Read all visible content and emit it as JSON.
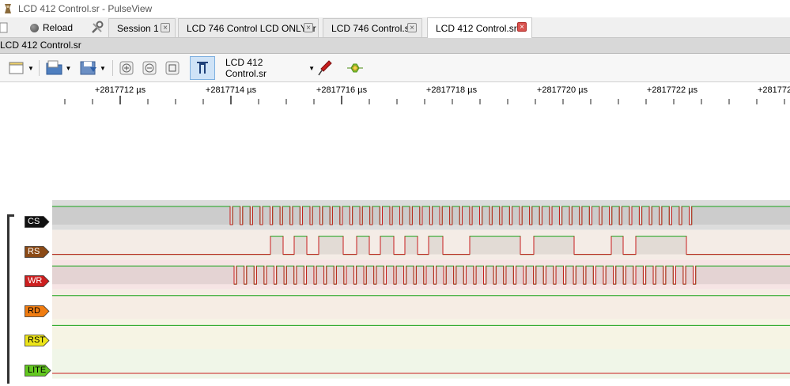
{
  "window": {
    "title": "LCD 412 Control.sr - PulseView"
  },
  "toolbar_top": {
    "reload_label": "Reload"
  },
  "tabs": [
    {
      "label": "Session 1",
      "active": false
    },
    {
      "label": "LCD 746 Control LCD ONLY.sr",
      "active": false
    },
    {
      "label": "LCD 746 Control.sr",
      "active": false
    },
    {
      "label": "LCD 412 Control.sr",
      "active": true
    }
  ],
  "session": {
    "name": "LCD 412 Control.sr",
    "device_label": "LCD 412 Control.sr"
  },
  "ruler": {
    "tick_labels": [
      "+2817712 µs",
      "+2817714 µs",
      "+2817716 µs",
      "+2817718 µs",
      "+2817720 µs",
      "+2817722 µs",
      "+281772"
    ]
  },
  "channels": [
    {
      "name": "CS",
      "color": "#111111",
      "text_color": "#ffffff",
      "bg": "#dcdcdc"
    },
    {
      "name": "RS",
      "color": "#8b4a16",
      "text_color": "#ffffff",
      "bg": "#f4ece6"
    },
    {
      "name": "WR",
      "color": "#cc1f1f",
      "text_color": "#ffffff",
      "bg": "#f6e4e4"
    },
    {
      "name": "RD",
      "color": "#f07c10",
      "text_color": "#000000",
      "bg": "#f6ede4"
    },
    {
      "name": "RST",
      "color": "#ece41a",
      "text_color": "#000000",
      "bg": "#f6f4e4"
    },
    {
      "name": "LITE",
      "color": "#63c820",
      "text_color": "#000000",
      "bg": "#f0f6e8"
    }
  ],
  "colors": {
    "high": "#1aa31a",
    "low": "#c81e1e"
  }
}
